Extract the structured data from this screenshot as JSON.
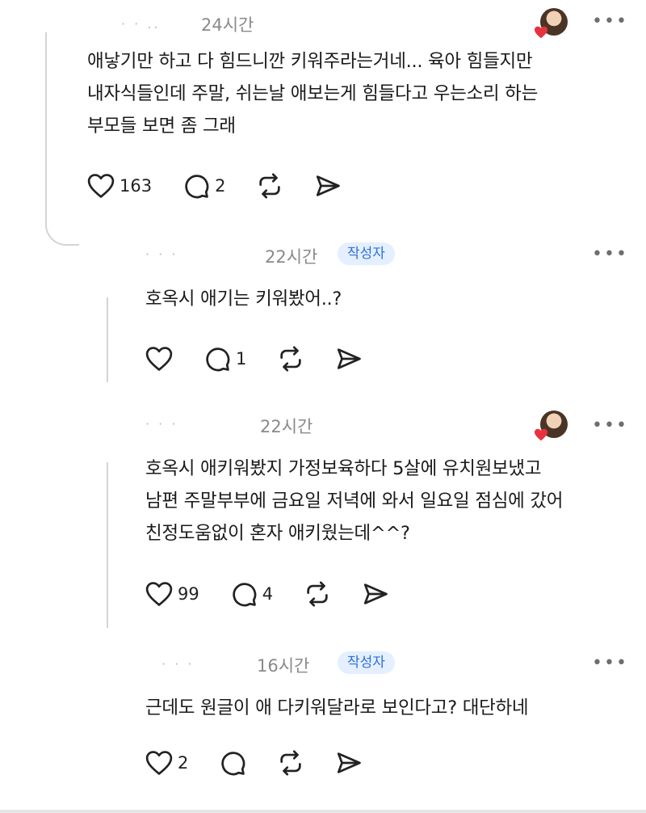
{
  "comments": [
    {
      "author_fragment": "· · ..",
      "time": "24시간",
      "badge": "",
      "text": "애낳기만 하고 다 힘드니깐 키워주라는거네... 육아 힘들지만\n내자식들인데 주말, 쉬는날 애보는게 힘들다고 우는소리 하는\n부모들 보면 좀 그래",
      "likes": "163",
      "replies": "2"
    },
    {
      "author_fragment": "·   ·  ·",
      "time": "22시간",
      "badge": "작성자",
      "text": "호옥시 애기는 키워봤어..?",
      "likes": "",
      "replies": "1"
    },
    {
      "author_fragment": "·    · ·",
      "time": "22시간",
      "badge": "",
      "text": "호옥시 애키워봤지 가정보육하다 5살에 유치원보냈고\n남편 주말부부에 금요일 저녁에 와서 일요일 점심에 갔어\n친정도움없이 혼자 애키웠는데^^?",
      "likes": "99",
      "replies": "4"
    },
    {
      "author_fragment": "·  ·   ·",
      "time": "16시간",
      "badge": "작성자",
      "text": "근데도 원글이 애 다키워달라로 보인다고? 대단하네",
      "likes": "2",
      "replies": ""
    }
  ],
  "more_label": "•••",
  "colors": {
    "badge_bg": "#e4efff",
    "badge_text": "#2f6fdc",
    "meta_text": "#8a8a8a",
    "heart_red": "#e8323f"
  },
  "icons": [
    "heart-icon",
    "comment-icon",
    "repost-icon",
    "share-icon",
    "more-icon",
    "avatar-heart-icon"
  ]
}
